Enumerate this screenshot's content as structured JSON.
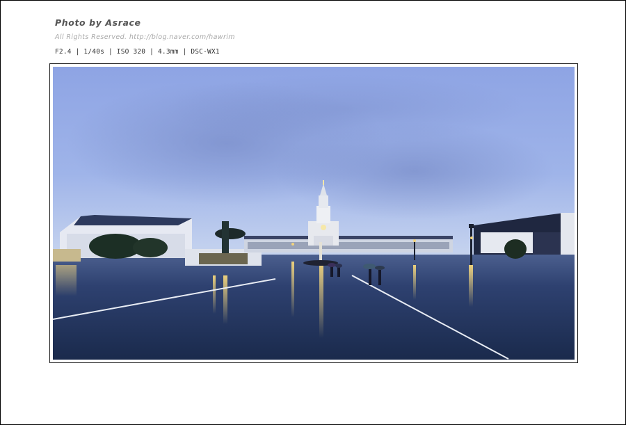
{
  "caption": {
    "title": "Photo by Asrace",
    "rights": "All Rights Reserved. http://blog.naver.com/hawrim",
    "exif": "F2.4 | 1/40s | ISO 320 | 4.3mm | DSC-WX1"
  },
  "photo": {
    "subject": "rain-soaked plaza with illuminated basilica tower at dusk",
    "colors": {
      "sky_top": "#8fa6e6",
      "sky_bottom": "#c6d4ef",
      "pavement": "#1f2f52",
      "light_reflection": "#f2d27a"
    }
  }
}
